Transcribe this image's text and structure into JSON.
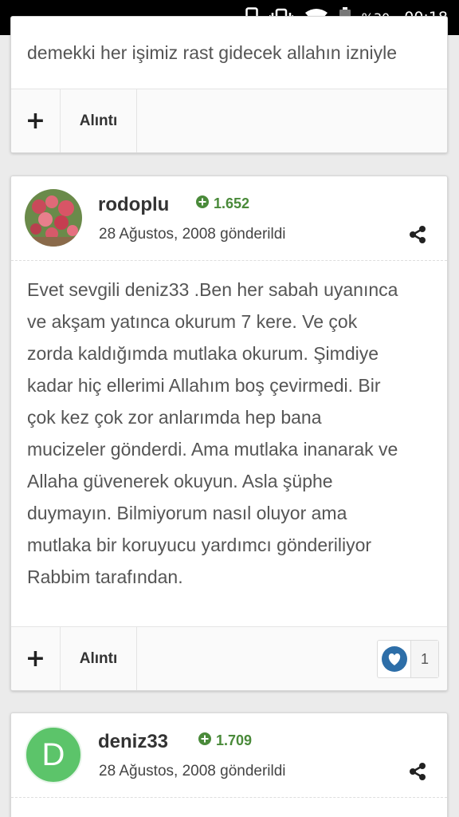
{
  "status_bar": {
    "battery_percent": "%30",
    "time": "00:18",
    "icons": [
      "phone-outline-icon",
      "vibrate-icon",
      "wifi-icon",
      "battery-icon"
    ]
  },
  "posts": [
    {
      "text": "demekki her işimiz rast gidecek allahın izniyle",
      "actions": {
        "plus": "+",
        "quote": "Alıntı"
      }
    },
    {
      "author": "rodoplu",
      "reputation": "1.652",
      "date": "28 Ağustos, 2008 gönderildi",
      "avatar": "photo",
      "body_lines": [
        "Evet sevgili deniz33 .Ben her sabah uyanınca",
        "ve akşam yatınca okurum 7 kere. Ve çok",
        "zorda kaldığımda mutlaka okurum. Şimdiye",
        "kadar hiç ellerimi Allahım boş çevirmedi. Bir",
        "çok kez çok zor anlarımda hep bana",
        "mucizeler gönderdi. Ama mutlaka inanarak ve",
        "Allaha güvenerek okuyun. Asla şüphe",
        "duymayın. Bilmiyorum nasıl oluyor ama",
        "mutlaka bir koruyucu yardımcı gönderiliyor",
        "Rabbim tarafından."
      ],
      "actions": {
        "plus": "+",
        "quote": "Alıntı"
      },
      "reaction": {
        "icon": "heart-icon",
        "count": "1"
      }
    },
    {
      "author": "deniz33",
      "reputation": "1.709",
      "date": "28 Ağustos, 2008 gönderildi",
      "avatar_letter": "D"
    }
  ],
  "colors": {
    "reputation_green": "#4a8a3a",
    "avatar_green": "#5cc46a",
    "heart_blue": "#2d6ea8"
  }
}
